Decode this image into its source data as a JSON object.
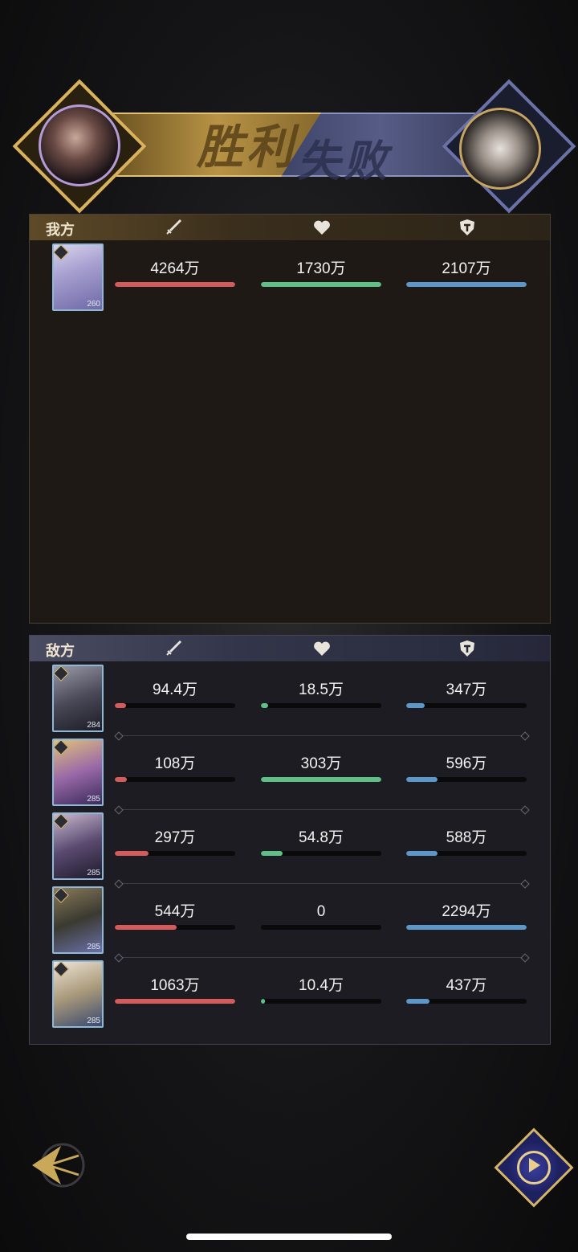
{
  "banner": {
    "victory_label": "胜利",
    "defeat_label": "失败"
  },
  "ally_panel": {
    "title": "我方",
    "rows": [
      {
        "level": "260",
        "atk": "4264万",
        "hp": "1730万",
        "def": "2107万",
        "atk_fill": 1.0,
        "hp_fill": 1.0,
        "def_fill": 1.0
      }
    ]
  },
  "enemy_panel": {
    "title": "敌方",
    "rows": [
      {
        "level": "284",
        "atk": "94.4万",
        "hp": "18.5万",
        "def": "347万",
        "atk_fill": 0.09,
        "hp_fill": 0.06,
        "def_fill": 0.15
      },
      {
        "level": "285",
        "atk": "108万",
        "hp": "303万",
        "def": "596万",
        "atk_fill": 0.1,
        "hp_fill": 1.0,
        "def_fill": 0.26
      },
      {
        "level": "285",
        "atk": "297万",
        "hp": "54.8万",
        "def": "588万",
        "atk_fill": 0.28,
        "hp_fill": 0.18,
        "def_fill": 0.26
      },
      {
        "level": "285",
        "atk": "544万",
        "hp": "0",
        "def": "2294万",
        "atk_fill": 0.51,
        "hp_fill": 0.0,
        "def_fill": 1.0
      },
      {
        "level": "285",
        "atk": "1063万",
        "hp": "10.4万",
        "def": "437万",
        "atk_fill": 1.0,
        "hp_fill": 0.03,
        "def_fill": 0.19
      }
    ]
  },
  "icons": {
    "attack": "sword-icon",
    "health": "heart-icon",
    "defense": "shield-icon",
    "back": "back-arrow-icon",
    "replay": "replay-icon"
  },
  "colors": {
    "attack": "#d35b5b",
    "health": "#5fbf86",
    "defense": "#5b97c9",
    "gold": "#d6b468"
  }
}
